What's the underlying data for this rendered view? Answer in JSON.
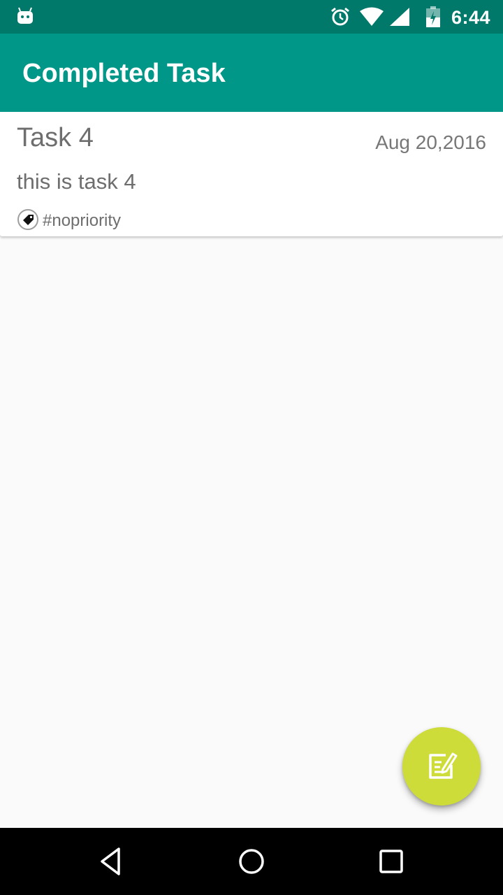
{
  "status_bar": {
    "time": "6:44",
    "icons": [
      "android-icon",
      "alarm-icon",
      "wifi-icon",
      "signal-icon",
      "battery-icon"
    ]
  },
  "app_bar": {
    "title": "Completed Task",
    "color": "#009688"
  },
  "tasks": [
    {
      "title": "Task 4",
      "date": "Aug 20,2016",
      "description": "this is task 4",
      "tag": "#nopriority",
      "tag_icon": "tag-icon"
    }
  ],
  "fab": {
    "icon": "edit-note-icon",
    "color": "#cddc39"
  },
  "nav_bar": {
    "buttons": [
      "back-icon",
      "home-icon",
      "recents-icon"
    ]
  }
}
